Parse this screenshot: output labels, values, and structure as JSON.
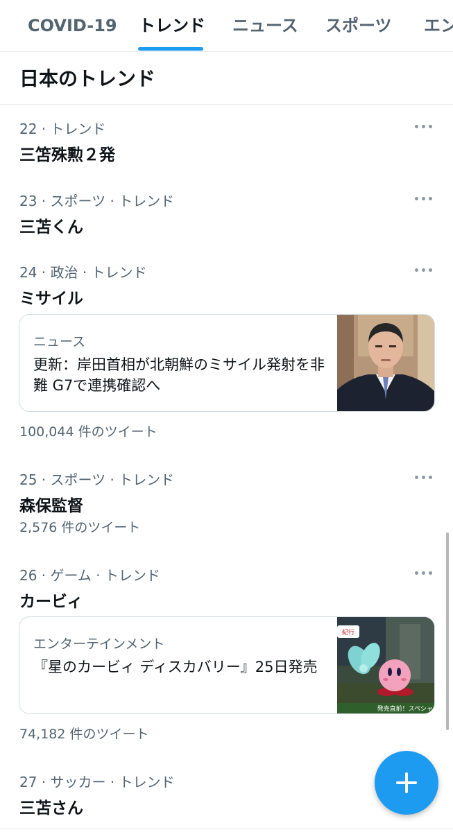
{
  "tabs": [
    {
      "label": "COVID-19"
    },
    {
      "label": "トレンド",
      "active": true
    },
    {
      "label": "ニュース"
    },
    {
      "label": "スポーツ"
    },
    {
      "label": "エン"
    }
  ],
  "section_title": "日本のトレンド",
  "trends": [
    {
      "rank": "22",
      "meta": "トレンド",
      "name": "三笘殊勲２発"
    },
    {
      "rank": "23",
      "meta": "スポーツ · トレンド",
      "name": "三苫くん"
    },
    {
      "rank": "24",
      "meta": "政治 · トレンド",
      "name": "ミサイル",
      "card": {
        "label": "ニュース",
        "headline": "更新：岸田首相が北朝鮮のミサイル発射を非難 G7で連携確認へ"
      },
      "tweet_count": "100,044 件のツイート"
    },
    {
      "rank": "25",
      "meta": "スポーツ · トレンド",
      "name": "森保監督",
      "tweet_count": "2,576 件のツイート"
    },
    {
      "rank": "26",
      "meta": "ゲーム · トレンド",
      "name": "カービィ",
      "card": {
        "label": "エンターテインメント",
        "headline": "『星のカービィ ディスカバリー』25日発売",
        "thumb_caption": "発売直前！スペシャ"
      },
      "tweet_count": "74,182 件のツイート"
    },
    {
      "rank": "27",
      "meta": "サッカー · トレンド",
      "name": "三苫さん"
    }
  ],
  "icons": {
    "more": "more-horizontal-icon",
    "compose": "plus-icon"
  },
  "colors": {
    "accent": "#1d9bf0",
    "text_primary": "#0f1419",
    "text_secondary": "#536471"
  }
}
